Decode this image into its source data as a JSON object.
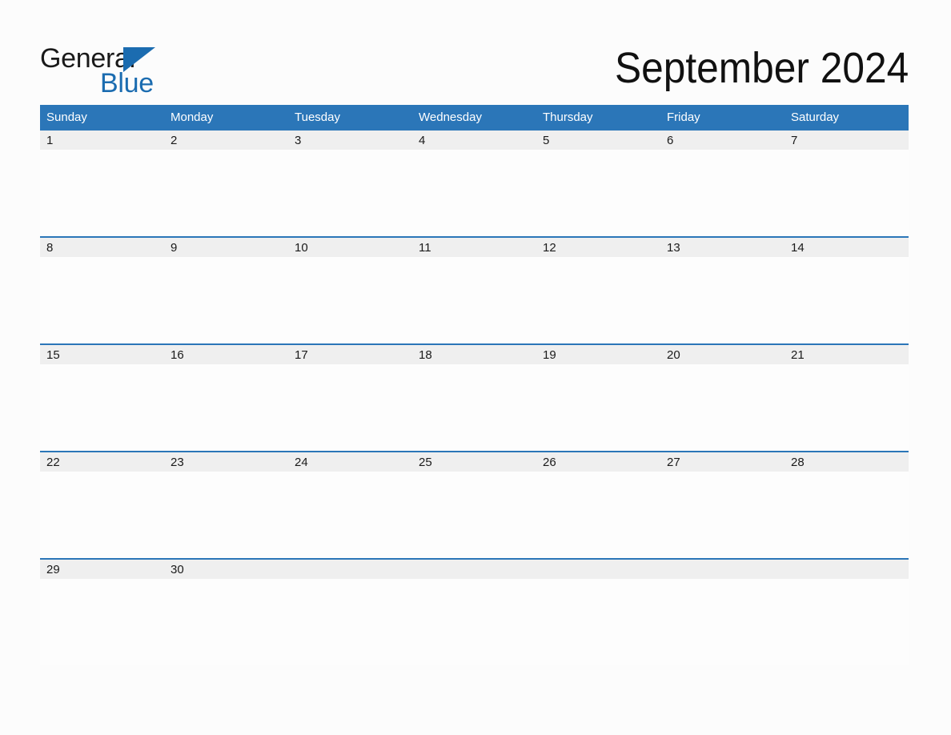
{
  "brand": {
    "name_part1": "General",
    "name_part2": "Blue",
    "accent_color": "#1b6cb0"
  },
  "header": {
    "title": "September 2024",
    "header_bg_color": "#2b76b8",
    "date_band_color": "#efefef",
    "page_bg_color": "#fcfcfc"
  },
  "weekdays": [
    {
      "label": "Sunday"
    },
    {
      "label": "Monday"
    },
    {
      "label": "Tuesday"
    },
    {
      "label": "Wednesday"
    },
    {
      "label": "Thursday"
    },
    {
      "label": "Friday"
    },
    {
      "label": "Saturday"
    }
  ],
  "weeks": [
    {
      "days": [
        {
          "date": "1",
          "note": ""
        },
        {
          "date": "2",
          "note": ""
        },
        {
          "date": "3",
          "note": ""
        },
        {
          "date": "4",
          "note": ""
        },
        {
          "date": "5",
          "note": ""
        },
        {
          "date": "6",
          "note": ""
        },
        {
          "date": "7",
          "note": ""
        }
      ]
    },
    {
      "days": [
        {
          "date": "8",
          "note": ""
        },
        {
          "date": "9",
          "note": ""
        },
        {
          "date": "10",
          "note": ""
        },
        {
          "date": "11",
          "note": ""
        },
        {
          "date": "12",
          "note": ""
        },
        {
          "date": "13",
          "note": ""
        },
        {
          "date": "14",
          "note": ""
        }
      ]
    },
    {
      "days": [
        {
          "date": "15",
          "note": ""
        },
        {
          "date": "16",
          "note": ""
        },
        {
          "date": "17",
          "note": ""
        },
        {
          "date": "18",
          "note": ""
        },
        {
          "date": "19",
          "note": ""
        },
        {
          "date": "20",
          "note": ""
        },
        {
          "date": "21",
          "note": ""
        }
      ]
    },
    {
      "days": [
        {
          "date": "22",
          "note": ""
        },
        {
          "date": "23",
          "note": ""
        },
        {
          "date": "24",
          "note": ""
        },
        {
          "date": "25",
          "note": ""
        },
        {
          "date": "26",
          "note": ""
        },
        {
          "date": "27",
          "note": ""
        },
        {
          "date": "28",
          "note": ""
        }
      ]
    },
    {
      "days": [
        {
          "date": "29",
          "note": ""
        },
        {
          "date": "30",
          "note": ""
        },
        {
          "date": "",
          "note": ""
        },
        {
          "date": "",
          "note": ""
        },
        {
          "date": "",
          "note": ""
        },
        {
          "date": "",
          "note": ""
        },
        {
          "date": "",
          "note": ""
        }
      ]
    }
  ]
}
